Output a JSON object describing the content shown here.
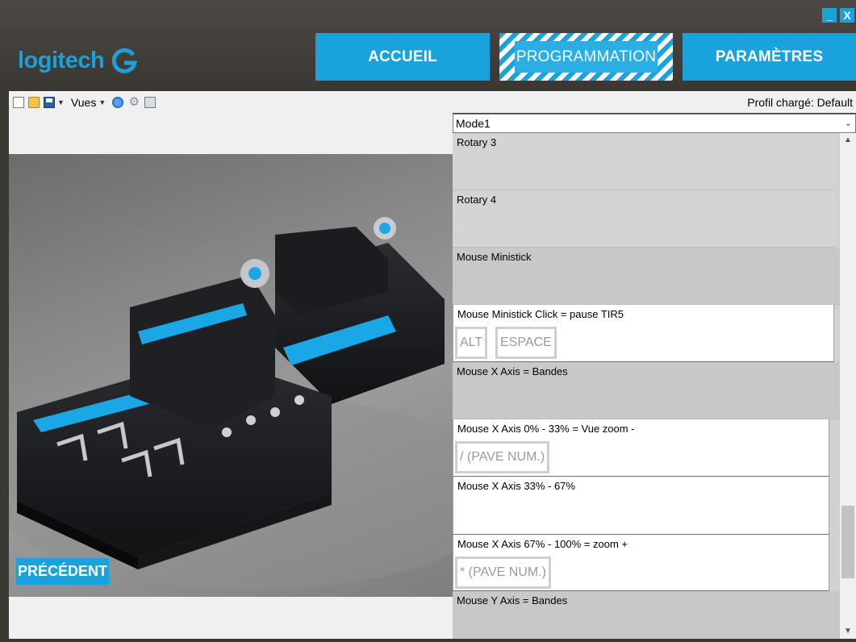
{
  "brand": {
    "name": "logitech"
  },
  "window": {
    "minimize": "_",
    "close": "X"
  },
  "nav": {
    "home": "ACCUEIL",
    "programming": "PROGRAMMATION",
    "settings": "PARAMÈTRES"
  },
  "toolbar": {
    "views_label": "Vues",
    "profile": "Profil chargé: Default"
  },
  "left": {
    "prev_button": "PRÉCÉDENT"
  },
  "mode": {
    "selected": "Mode1"
  },
  "list": {
    "items": [
      {
        "title": "Rotary 3"
      },
      {
        "title": "Rotary 4"
      },
      {
        "title": "Mouse Ministick"
      },
      {
        "title": "Mouse Ministick Click = pause TIR5",
        "keys": [
          "ALT",
          "ESPACE"
        ]
      },
      {
        "title": "Mouse X Axis = Bandes"
      },
      {
        "title": "Mouse X Axis 0% - 33% = Vue zoom -",
        "keys": [
          "/ (PAVE NUM.)"
        ]
      },
      {
        "title": "Mouse X Axis 33% - 67%"
      },
      {
        "title": "Mouse X Axis 67% - 100% = zoom +",
        "keys": [
          "* (PAVE NUM.)"
        ]
      },
      {
        "title": "Mouse Y Axis = Bandes"
      }
    ]
  },
  "icons": [
    "new-file-icon",
    "open-folder-icon",
    "save-icon",
    "globe-icon",
    "gear-icon",
    "print-icon",
    "logitech-g-icon"
  ],
  "colors": {
    "accent": "#19a2dc",
    "header_bg": "#45423d"
  }
}
